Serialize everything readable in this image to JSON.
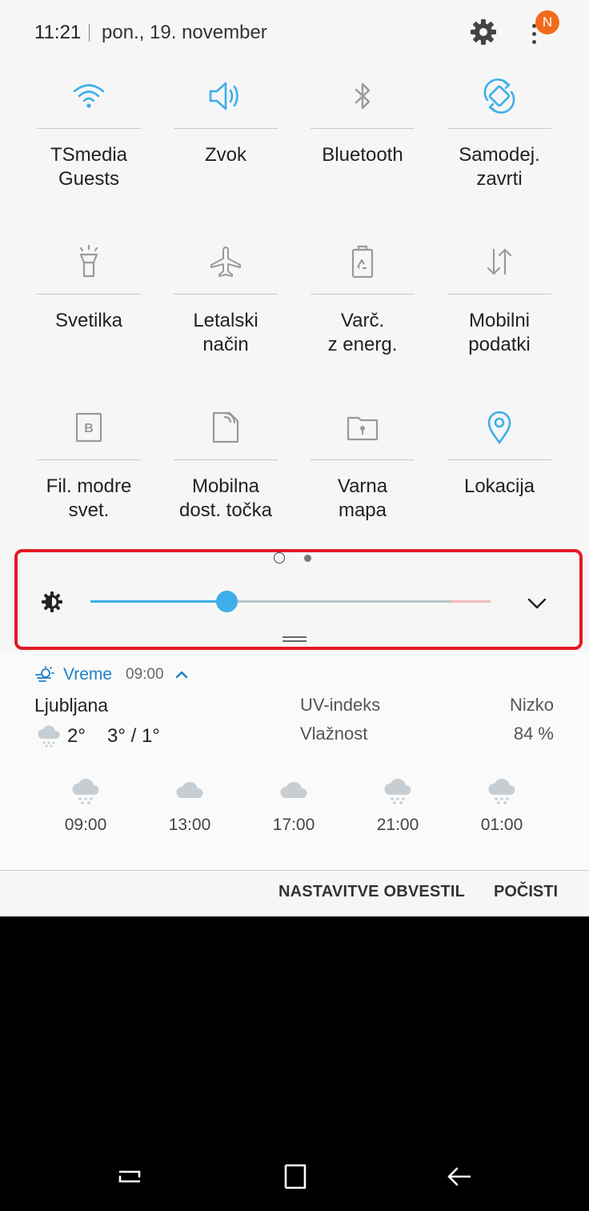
{
  "status": {
    "time": "11:21",
    "date": "pon., 19. november",
    "notification_badge": "N"
  },
  "tiles": [
    {
      "label": "TSmedia\nGuests",
      "icon": "wifi-icon",
      "active": true
    },
    {
      "label": "Zvok",
      "icon": "speaker-icon",
      "active": true
    },
    {
      "label": "Bluetooth",
      "icon": "bluetooth-icon",
      "active": false
    },
    {
      "label": "Samodej.\nzavrti",
      "icon": "auto-rotate-icon",
      "active": true
    },
    {
      "label": "Svetilka",
      "icon": "flashlight-icon",
      "active": false
    },
    {
      "label": "Letalski\nnačin",
      "icon": "airplane-icon",
      "active": false
    },
    {
      "label": "Varč.\nz energ.",
      "icon": "power-saving-icon",
      "active": false
    },
    {
      "label": "Mobilni\npodatki",
      "icon": "mobile-data-icon",
      "active": false
    },
    {
      "label": "Fil. modre\nsvet.",
      "icon": "blue-light-filter-icon",
      "active": false
    },
    {
      "label": "Mobilna\ndost. točka",
      "icon": "hotspot-icon",
      "active": false
    },
    {
      "label": "Varna\nmapa",
      "icon": "secure-folder-icon",
      "active": false
    },
    {
      "label": "Lokacija",
      "icon": "location-icon",
      "active": true
    }
  ],
  "brightness": {
    "level": 0.34,
    "icon": "brightness-icon"
  },
  "weather": {
    "title": "Vreme",
    "time": "09:00",
    "city": "Ljubljana",
    "current_temp": "2°",
    "range": "3° / 1°",
    "uv_label": "UV-indeks",
    "uv_value": "Nizko",
    "humidity_label": "Vlažnost",
    "humidity_value": "84 %",
    "forecast": [
      {
        "time": "09:00",
        "icon": "snow-cloud-icon"
      },
      {
        "time": "13:00",
        "icon": "cloud-icon"
      },
      {
        "time": "17:00",
        "icon": "cloud-icon"
      },
      {
        "time": "21:00",
        "icon": "snow-cloud-icon"
      },
      {
        "time": "01:00",
        "icon": "snow-cloud-icon"
      }
    ]
  },
  "actions": {
    "notification_settings": "NASTAVITVE OBVESTIL",
    "clear": "POČISTI"
  },
  "colors": {
    "accent": "#3daee9",
    "inactive_icon": "#9a9a9a",
    "highlight": "#e21b25",
    "badge": "#f26b1d"
  }
}
